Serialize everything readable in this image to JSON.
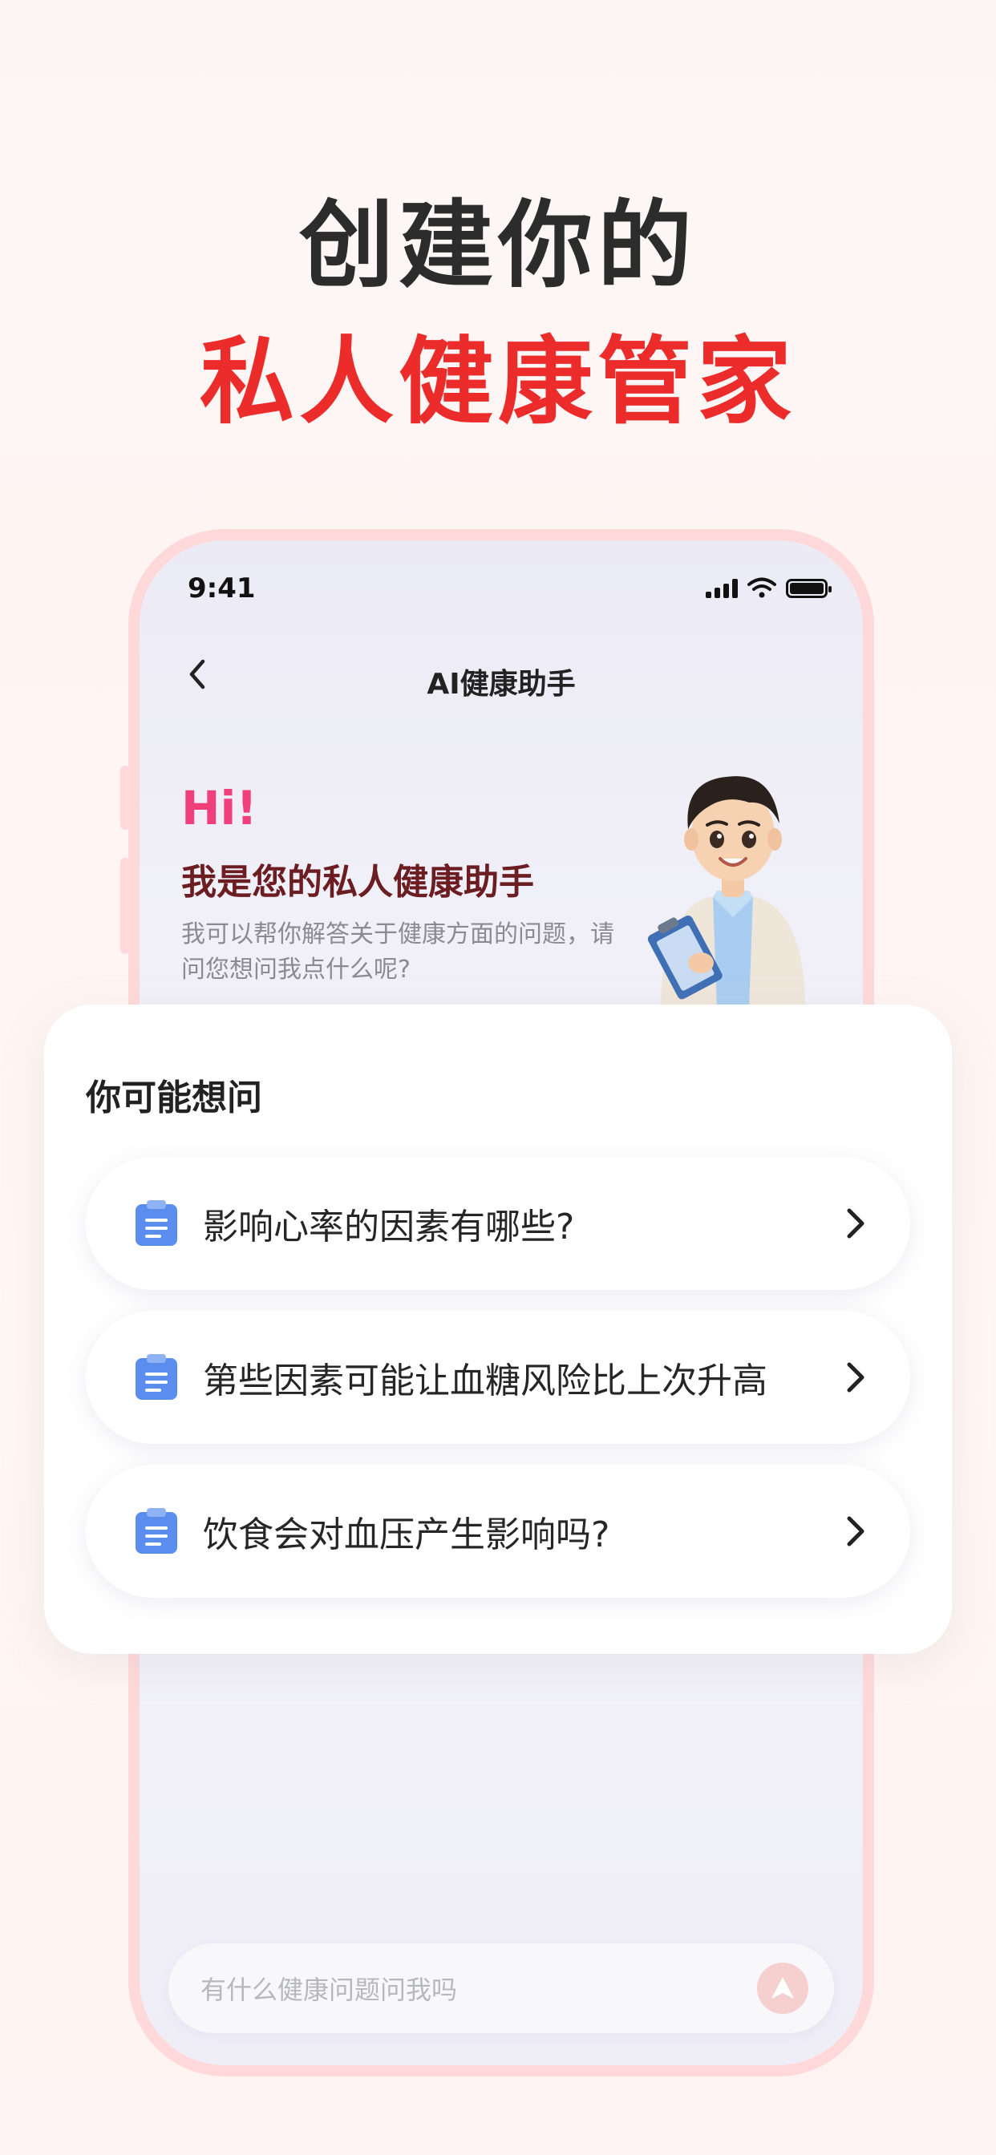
{
  "headline": {
    "line1": "创建你的",
    "line2": "私人健康管家"
  },
  "status_bar": {
    "time": "9:41",
    "icons": [
      "signal-icon",
      "wifi-icon",
      "battery-icon"
    ]
  },
  "nav": {
    "back_icon": "chevron-left-icon",
    "title": "AI健康助手"
  },
  "intro": {
    "greeting": "Hi!",
    "title": "我是您的私人健康助手",
    "description": "我可以帮你解答关于健康方面的问题，请问您想问我点什么呢?"
  },
  "suggestions": {
    "title": "你可能想问",
    "items": [
      {
        "label": "影响心率的因素有哪些?",
        "icon": "clipboard-icon"
      },
      {
        "label": "第些因素可能让血糖风险比上次升高",
        "icon": "clipboard-icon"
      },
      {
        "label": "饮食会对血压产生影响吗?",
        "icon": "clipboard-icon"
      }
    ]
  },
  "input": {
    "placeholder": "有什么健康问题问我吗",
    "send_icon": "send-icon"
  },
  "colors": {
    "brand_red": "#ec2b2b",
    "greeting_pink": "#f0407b",
    "phone_frame": "#ffd9d9",
    "clipboard_blue": "#5b8def"
  }
}
